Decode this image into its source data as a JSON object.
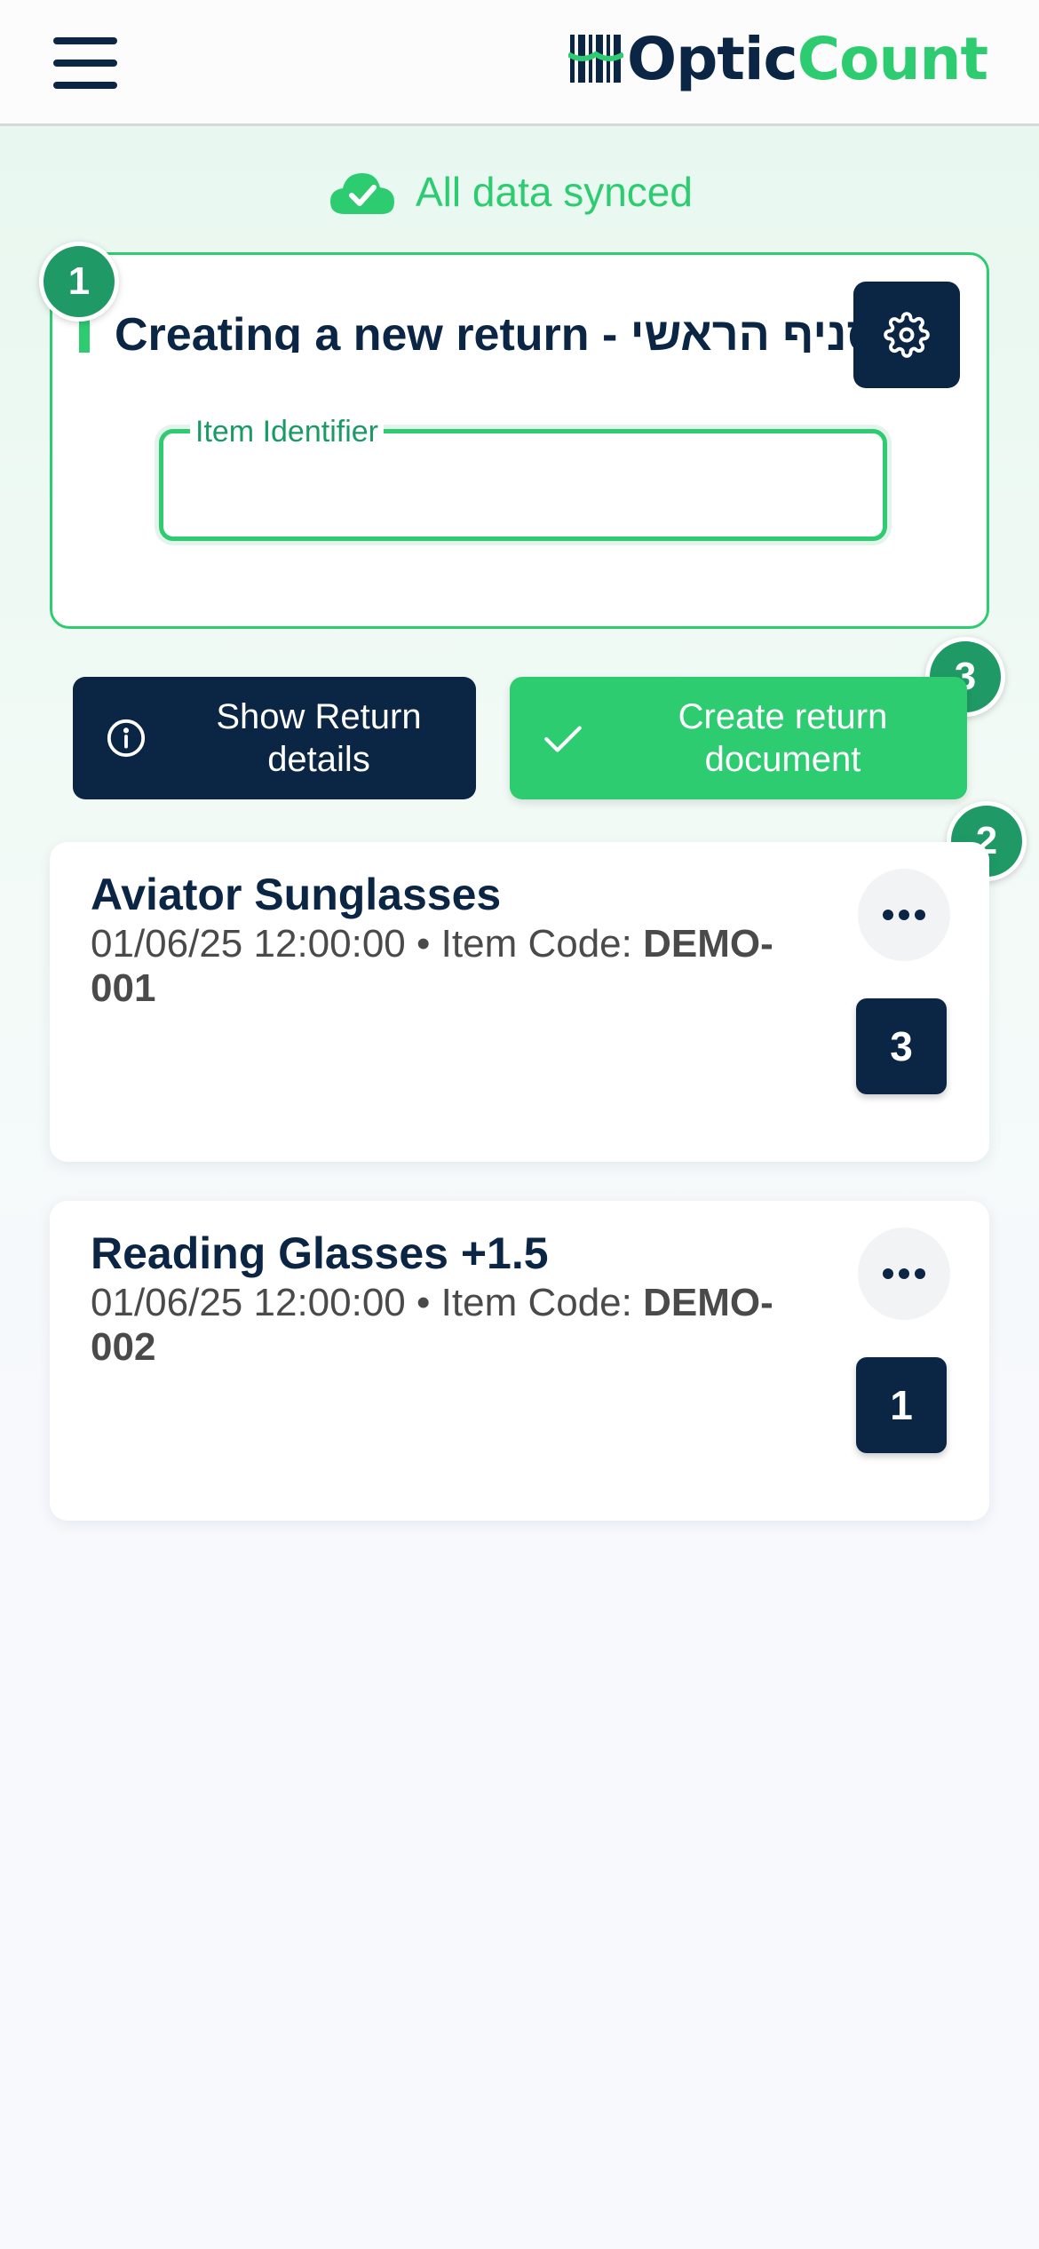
{
  "header": {
    "logo_part1": "Optic",
    "logo_part2": "Count"
  },
  "sync": {
    "status_text": "All data synced"
  },
  "new_return": {
    "title": "Creating a new return - סניף הראשי",
    "field_label": "Item Identifier",
    "field_value": ""
  },
  "badges": {
    "step1": "1",
    "step2": "2",
    "step3": "3"
  },
  "actions": {
    "show_details_label": "Show Return details",
    "create_document_label": "Create return document"
  },
  "items": [
    {
      "name": "Aviator Sunglasses",
      "datetime": "01/06/25 12:00:00",
      "separator": "•",
      "code_label": "Item Code:",
      "code": "DEMO-001",
      "quantity": "3"
    },
    {
      "name": "Reading Glasses +1.5",
      "datetime": "01/06/25 12:00:00",
      "separator": "•",
      "code_label": "Item Code:",
      "code": "DEMO-002",
      "quantity": "1"
    }
  ],
  "colors": {
    "navy": "#0b2545",
    "green": "#2ecc71",
    "badge_green": "#1f9a66"
  }
}
